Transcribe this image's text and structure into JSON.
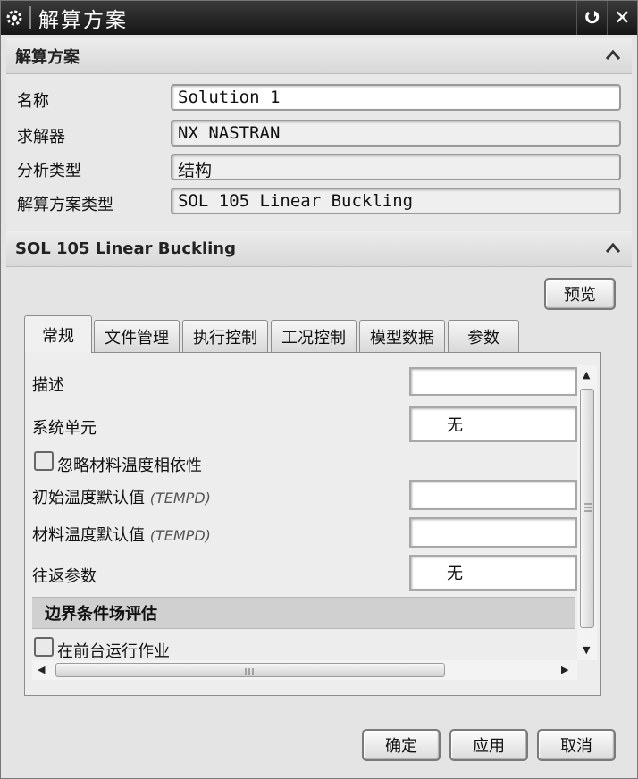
{
  "window": {
    "title": "解算方案",
    "restore_icon": "refresh-icon",
    "close_icon": "close-icon"
  },
  "section1": {
    "title": "解算方案",
    "fields": [
      {
        "label": "名称",
        "value": "Solution 1"
      },
      {
        "label": "求解器",
        "value": "NX NASTRAN"
      },
      {
        "label": "分析类型",
        "value": "结构"
      },
      {
        "label": "解算方案类型",
        "value": "SOL 105 Linear Buckling"
      }
    ]
  },
  "section2": {
    "title": "SOL 105 Linear Buckling",
    "preview_label": "预览",
    "tabs": [
      "常规",
      "文件管理",
      "执行控制",
      "工况控制",
      "模型数据",
      "参数"
    ],
    "active_tab": 0,
    "panel": {
      "description_label": "描述",
      "description_value": "",
      "system_cell_label": "系统单元",
      "system_cell_value": "无",
      "ignore_temp_label": "忽略材料温度相依性",
      "init_temp_label": "初始温度默认值",
      "init_temp_code": "(TEMPD)",
      "init_temp_value": "",
      "mat_temp_label": "材料温度默认值",
      "mat_temp_code": "(TEMPD)",
      "mat_temp_value": "",
      "roundtrip_label": "往返参数",
      "roundtrip_value": "无",
      "boundary_group": "边界条件场评估",
      "foreground_label": "在前台运行作业"
    }
  },
  "footer": {
    "ok_label": "确定",
    "apply_label": "应用",
    "cancel_label": "取消"
  }
}
